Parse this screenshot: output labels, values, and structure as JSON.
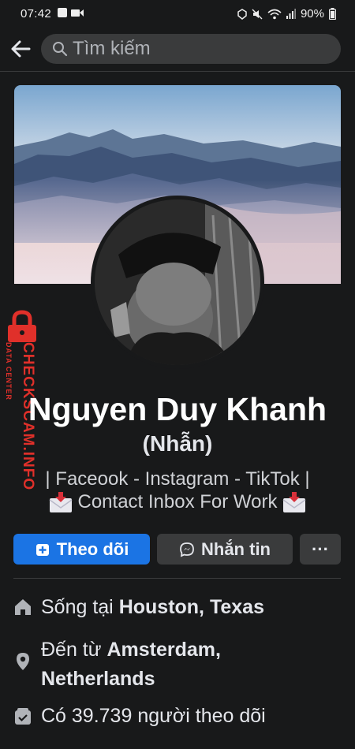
{
  "status_bar": {
    "time": "07:42",
    "battery": "90%"
  },
  "search": {
    "placeholder": "Tìm kiếm"
  },
  "watermark": {
    "brand": "CHECKSCAM.INFO",
    "sub": "DATA CENTER"
  },
  "profile": {
    "name": "Nguyen Duy Khanh",
    "alt_name": "(Nhẫn)",
    "bio_line1": "| Faceook - Instagram - TikTok |",
    "bio_line2": "Contact Inbox For Work"
  },
  "actions": {
    "follow": "Theo dõi",
    "message": "Nhắn tin",
    "more": "···"
  },
  "info": {
    "lives_prefix": "Sống tại ",
    "lives_place": "Houston, Texas",
    "from_prefix": "Đến từ ",
    "from_place_1": "Amsterdam,",
    "from_place_2": "Netherlands",
    "followers": "Có 39.739 người theo dõi"
  },
  "colors": {
    "accent": "#1b74e4",
    "background": "#18191a",
    "surface": "#3a3b3c",
    "watermark": "#e0302a"
  }
}
